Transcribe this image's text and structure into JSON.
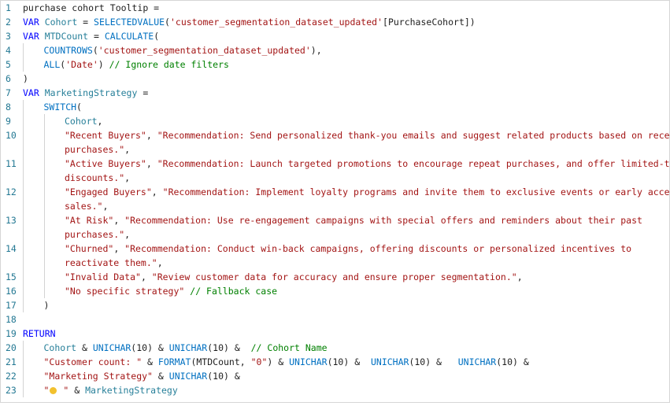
{
  "colors": {
    "line_number": "#237893",
    "keyword": "#0000ff",
    "function": "#0070c1",
    "variable": "#267f99",
    "string": "#a31515",
    "comment": "#008000",
    "text": "#1e1e1e",
    "lightbulb": "#f2c12e"
  },
  "lines": [
    {
      "n": "1",
      "indent": 0,
      "tokens": [
        [
          "text",
          "purchase cohort Tooltip ="
        ]
      ]
    },
    {
      "n": "2",
      "indent": 0,
      "tokens": [
        [
          "kw",
          "VAR "
        ],
        [
          "var",
          "Cohort"
        ],
        [
          "op",
          " = "
        ],
        [
          "fn",
          "SELECTEDVALUE"
        ],
        [
          "op",
          "("
        ],
        [
          "str",
          "'customer_segmentation_dataset_updated'"
        ],
        [
          "op",
          "[PurchaseCohort])"
        ]
      ]
    },
    {
      "n": "3",
      "indent": 0,
      "tokens": [
        [
          "kw",
          "VAR "
        ],
        [
          "var",
          "MTDCount"
        ],
        [
          "op",
          " = "
        ],
        [
          "fn",
          "CALCULATE"
        ],
        [
          "op",
          "("
        ]
      ]
    },
    {
      "n": "4",
      "indent": 1,
      "tokens": [
        [
          "fn",
          "COUNTROWS"
        ],
        [
          "op",
          "("
        ],
        [
          "str",
          "'customer_segmentation_dataset_updated'"
        ],
        [
          "op",
          "),"
        ]
      ]
    },
    {
      "n": "5",
      "indent": 1,
      "tokens": [
        [
          "fn",
          "ALL"
        ],
        [
          "op",
          "("
        ],
        [
          "str",
          "'Date'"
        ],
        [
          "op",
          ") "
        ],
        [
          "com",
          "// Ignore date filters"
        ]
      ]
    },
    {
      "n": "6",
      "indent": 0,
      "tokens": [
        [
          "op",
          ")"
        ]
      ]
    },
    {
      "n": "7",
      "indent": 0,
      "tokens": [
        [
          "kw",
          "VAR "
        ],
        [
          "var",
          "MarketingStrategy"
        ],
        [
          "op",
          " ="
        ]
      ]
    },
    {
      "n": "8",
      "indent": 1,
      "tokens": [
        [
          "fn",
          "SWITCH"
        ],
        [
          "op",
          "("
        ]
      ]
    },
    {
      "n": "9",
      "indent": 2,
      "tokens": [
        [
          "var",
          "Cohort"
        ],
        [
          "op",
          ","
        ]
      ]
    },
    {
      "n": "10",
      "indent": 2,
      "tokens": [
        [
          "str",
          "\"Recent Buyers\""
        ],
        [
          "op",
          ", "
        ],
        [
          "str",
          "\"Recommendation: Send personalized thank-you emails and suggest related products based on recent"
        ]
      ]
    },
    {
      "n": "",
      "indent": 2,
      "tokens": [
        [
          "str",
          "purchases.\""
        ],
        [
          "op",
          ","
        ]
      ]
    },
    {
      "n": "11",
      "indent": 2,
      "tokens": [
        [
          "str",
          "\"Active Buyers\""
        ],
        [
          "op",
          ", "
        ],
        [
          "str",
          "\"Recommendation: Launch targeted promotions to encourage repeat purchases, and offer limited-time"
        ]
      ]
    },
    {
      "n": "",
      "indent": 2,
      "tokens": [
        [
          "str",
          "discounts.\""
        ],
        [
          "op",
          ","
        ]
      ]
    },
    {
      "n": "12",
      "indent": 2,
      "tokens": [
        [
          "str",
          "\"Engaged Buyers\""
        ],
        [
          "op",
          ", "
        ],
        [
          "str",
          "\"Recommendation: Implement loyalty programs and invite them to exclusive events or early access"
        ]
      ]
    },
    {
      "n": "",
      "indent": 2,
      "tokens": [
        [
          "str",
          "sales.\""
        ],
        [
          "op",
          ","
        ]
      ]
    },
    {
      "n": "13",
      "indent": 2,
      "tokens": [
        [
          "str",
          "\"At Risk\""
        ],
        [
          "op",
          ", "
        ],
        [
          "str",
          "\"Recommendation: Use re-engagement campaigns with special offers and reminders about their past"
        ]
      ]
    },
    {
      "n": "",
      "indent": 2,
      "tokens": [
        [
          "str",
          "purchases.\""
        ],
        [
          "op",
          ","
        ]
      ]
    },
    {
      "n": "14",
      "indent": 2,
      "tokens": [
        [
          "str",
          "\"Churned\""
        ],
        [
          "op",
          ", "
        ],
        [
          "str",
          "\"Recommendation: Conduct win-back campaigns, offering discounts or personalized incentives to"
        ]
      ]
    },
    {
      "n": "",
      "indent": 2,
      "tokens": [
        [
          "str",
          "reactivate them.\""
        ],
        [
          "op",
          ","
        ]
      ]
    },
    {
      "n": "15",
      "indent": 2,
      "tokens": [
        [
          "str",
          "\"Invalid Data\""
        ],
        [
          "op",
          ", "
        ],
        [
          "str",
          "\"Review customer data for accuracy and ensure proper segmentation.\""
        ],
        [
          "op",
          ","
        ]
      ]
    },
    {
      "n": "16",
      "indent": 2,
      "tokens": [
        [
          "str",
          "\"No specific strategy\""
        ],
        [
          "op",
          " "
        ],
        [
          "com",
          "// Fallback case"
        ]
      ]
    },
    {
      "n": "17",
      "indent": 1,
      "tokens": [
        [
          "op",
          ")"
        ]
      ]
    },
    {
      "n": "18",
      "indent": 0,
      "tokens": []
    },
    {
      "n": "19",
      "indent": 0,
      "tokens": [
        [
          "kw",
          "RETURN"
        ]
      ]
    },
    {
      "n": "20",
      "indent": 1,
      "tokens": [
        [
          "var",
          "Cohort"
        ],
        [
          "op",
          " & "
        ],
        [
          "fn",
          "UNICHAR"
        ],
        [
          "op",
          "(10) & "
        ],
        [
          "fn",
          "UNICHAR"
        ],
        [
          "op",
          "(10) &  "
        ],
        [
          "com",
          "// Cohort Name"
        ]
      ]
    },
    {
      "n": "21",
      "indent": 1,
      "tokens": [
        [
          "str",
          "\"Customer count: \""
        ],
        [
          "op",
          " & "
        ],
        [
          "fn",
          "FORMAT"
        ],
        [
          "op",
          "(MTDCount, "
        ],
        [
          "str",
          "\"0\""
        ],
        [
          "op",
          ") & "
        ],
        [
          "fn",
          "UNICHAR"
        ],
        [
          "op",
          "(10) &  "
        ],
        [
          "fn",
          "UNICHAR"
        ],
        [
          "op",
          "(10) &   "
        ],
        [
          "fn",
          "UNICHAR"
        ],
        [
          "op",
          "(10) &"
        ]
      ]
    },
    {
      "n": "22",
      "indent": 1,
      "tokens": [
        [
          "str",
          "\"Marketing Strategy\""
        ],
        [
          "op",
          " & "
        ],
        [
          "fn",
          "UNICHAR"
        ],
        [
          "op",
          "(10) &"
        ]
      ]
    },
    {
      "n": "23",
      "indent": 1,
      "tokens": [
        [
          "str",
          "\""
        ],
        [
          "bulb",
          "lightbulb-icon"
        ],
        [
          "str",
          " \""
        ],
        [
          "op",
          " & "
        ],
        [
          "var",
          "MarketingStrategy"
        ]
      ]
    }
  ]
}
